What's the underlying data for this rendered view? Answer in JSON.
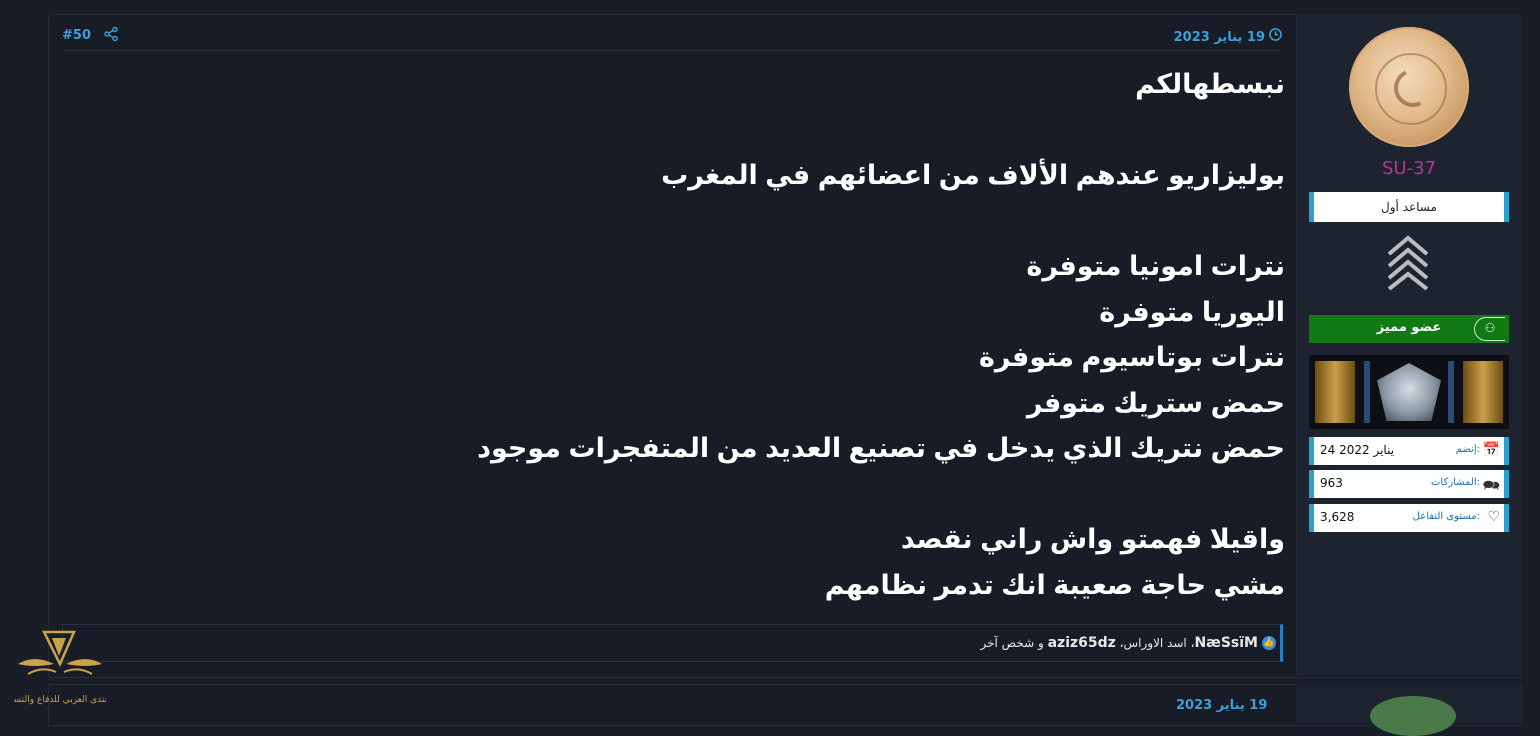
{
  "post": {
    "date": "19 يناير 2023",
    "number": "#50",
    "lines": [
      "نبسطهالكم",
      "",
      "بوليزاريو عندهم الألاف من اعضائهم في المغرب",
      "",
      "نترات امونيا متوفرة",
      "اليوريا متوفرة",
      "نترات بوتاسيوم متوفرة",
      "حمض ستريك متوفر",
      "حمض نتريك الذي يدخل في تصنيع العديد من المتفجرات موجود",
      "",
      "واقيلا فهمتو واش راني نقصد",
      "مشي حاجة صعيبة انك تدمر نظامهم"
    ],
    "reactions": {
      "user1": "NæSsïM",
      "sep1": "، ",
      "user2": "اسد الاوراس",
      "sep2": "، ",
      "user3": "aziz65dz",
      "rest": " و شخص آخر"
    }
  },
  "author": {
    "username": "SU-37",
    "title": "مساعد أول",
    "member_badge": "عضو مميز",
    "joined_label": "إنضم:",
    "joined_value": "24 يناير 2022",
    "posts_label": "المشاركات:",
    "posts_value": "963",
    "reaction_label": "مستوى التفاعل:",
    "reaction_value": "3,628"
  },
  "next_post": {
    "date": "19 يناير 2023"
  },
  "site": {
    "logo_text": "المنتدى العربي للدفاع والتسليح"
  },
  "colors": {
    "background": "#191d27",
    "accent_blue": "#3f9fd6",
    "username": "#b03a8e",
    "member_green": "#127a14"
  }
}
